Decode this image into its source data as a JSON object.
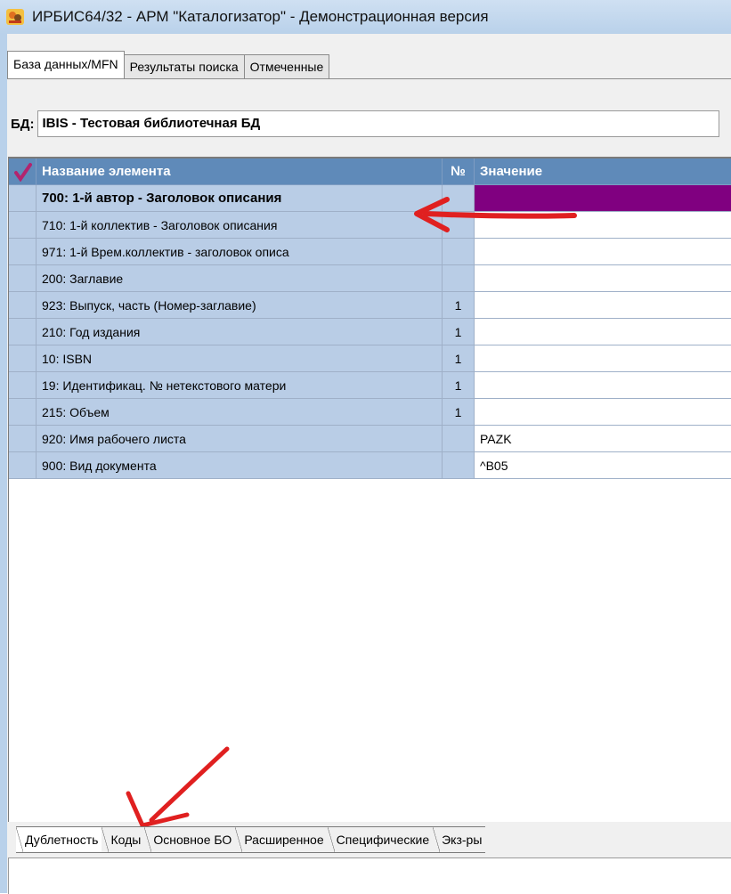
{
  "window": {
    "title": "ИРБИС64/32 - АРМ \"Каталогизатор\" - Демонстрационная версия",
    "icon": "irbis-app-icon"
  },
  "tabs": [
    {
      "label": "База данных/MFN",
      "active": true
    },
    {
      "label": "Результаты поиска",
      "active": false
    },
    {
      "label": "Отмеченные",
      "active": false
    }
  ],
  "database": {
    "label": "БД:",
    "value": "IBIS - Тестовая библиотечная БД"
  },
  "grid": {
    "columns": {
      "check_icon": "checkmark-icon",
      "name": "Название элемента",
      "num": "№",
      "value": "Значение"
    },
    "rows": [
      {
        "name": "700: 1-й  автор - Заголовок описания",
        "num": "",
        "value": "",
        "bold": true,
        "selected": true
      },
      {
        "name": "710: 1-й коллектив - Заголовок описания",
        "num": "",
        "value": ""
      },
      {
        "name": "971: 1-й Врем.коллектив - заголовок описа",
        "num": "",
        "value": ""
      },
      {
        "name": "200: Заглавие",
        "num": "",
        "value": ""
      },
      {
        "name": "923: Выпуск, часть (Номер-заглавие)",
        "num": "1",
        "value": ""
      },
      {
        "name": "210: Год издания",
        "num": "1",
        "value": ""
      },
      {
        "name": "10: ISBN",
        "num": "1",
        "value": ""
      },
      {
        "name": "19: Идентификац. № нетекстового матери",
        "num": "1",
        "value": ""
      },
      {
        "name": "215: Объем",
        "num": "1",
        "value": ""
      },
      {
        "name": "920: Имя рабочего листа",
        "num": "",
        "value": "PAZK"
      },
      {
        "name": "900: Вид документа",
        "num": "",
        "value": "^B05"
      }
    ],
    "selected_color": "#800080"
  },
  "bottom_tabs": [
    {
      "label": "Дублетность",
      "active": true
    },
    {
      "label": "Коды",
      "active": false
    },
    {
      "label": "Основное БО",
      "active": false
    },
    {
      "label": "Расширенное",
      "active": false
    },
    {
      "label": "Специфические",
      "active": false
    },
    {
      "label": "Экз-ры",
      "active": false
    }
  ],
  "annotations": {
    "arrow_color": "#e02020",
    "arrow_1": "red-arrow-annotation",
    "arrow_2": "red-arrow-annotation"
  }
}
